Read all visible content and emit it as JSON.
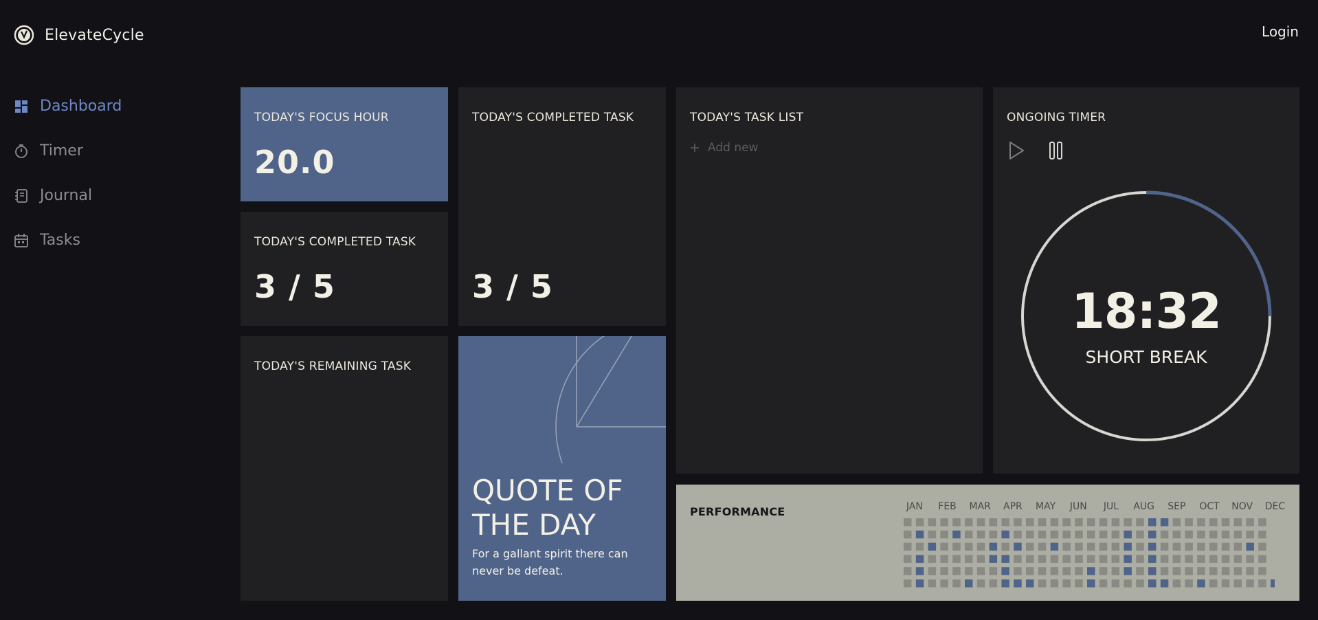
{
  "app": {
    "name": "ElevateCycle",
    "login_label": "Login"
  },
  "nav": {
    "items": [
      {
        "label": "Dashboard",
        "icon": "dashboard-icon",
        "active": true
      },
      {
        "label": "Timer",
        "icon": "timer-icon",
        "active": false
      },
      {
        "label": "Journal",
        "icon": "journal-icon",
        "active": false
      },
      {
        "label": "Tasks",
        "icon": "calendar-icon",
        "active": false
      }
    ]
  },
  "cards": {
    "focus_hour": {
      "title": "TODAY'S FOCUS HOUR",
      "value": "20.0"
    },
    "completed_small": {
      "title": "TODAY'S COMPLETED TASK",
      "value": "3 / 5"
    },
    "completed_tall": {
      "title": "TODAY'S COMPLETED TASK",
      "value": "3 / 5"
    },
    "remaining": {
      "title": "TODAY'S REMAINING TASK"
    },
    "quote": {
      "title_line1": "QUOTE OF",
      "title_line2": "THE DAY",
      "text": "For a gallant spirit there can never be defeat."
    },
    "task_list": {
      "title": "TODAY'S TASK LIST",
      "add_label": "Add new"
    },
    "timer": {
      "title": "ONGOING TIMER",
      "time": "18:32",
      "mode": "SHORT BREAK",
      "progress": 0.25
    },
    "performance": {
      "title": "PERFORMANCE",
      "months": [
        "JAN",
        "FEB",
        "MAR",
        "APR",
        "MAY",
        "JUN",
        "JUL",
        "AUG",
        "SEP",
        "OCT",
        "NOV",
        "DEC"
      ],
      "highlighted_cells": [
        [
          0,
          20
        ],
        [
          0,
          21
        ],
        [
          1,
          1
        ],
        [
          1,
          4
        ],
        [
          1,
          8
        ],
        [
          1,
          18
        ],
        [
          1,
          20
        ],
        [
          2,
          2
        ],
        [
          2,
          7
        ],
        [
          2,
          9
        ],
        [
          2,
          12
        ],
        [
          2,
          18
        ],
        [
          2,
          20
        ],
        [
          2,
          28
        ],
        [
          3,
          1
        ],
        [
          3,
          7
        ],
        [
          3,
          8
        ],
        [
          3,
          18
        ],
        [
          3,
          20
        ],
        [
          4,
          1
        ],
        [
          4,
          8
        ],
        [
          4,
          15
        ],
        [
          4,
          18
        ],
        [
          4,
          20
        ],
        [
          5,
          1
        ],
        [
          5,
          5
        ],
        [
          5,
          8
        ],
        [
          5,
          9
        ],
        [
          5,
          10
        ],
        [
          5,
          15
        ],
        [
          5,
          20
        ],
        [
          5,
          21
        ],
        [
          5,
          24
        ],
        [
          5,
          30
        ]
      ],
      "colors": {
        "base": "#8a8a84",
        "active": "#50648a"
      }
    }
  },
  "colors": {
    "accent": "#6e88c7",
    "card_blue": "#50648a",
    "card_dark": "#202022",
    "background": "#111116"
  }
}
